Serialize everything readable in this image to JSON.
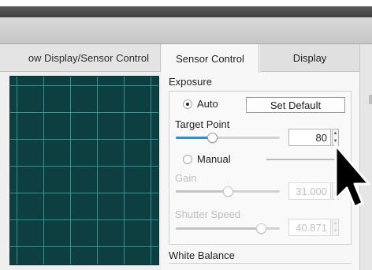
{
  "left_pane": {
    "tab_label": "ow Display/Sensor Control"
  },
  "tabs": [
    {
      "label": "Sensor Control",
      "selected": true
    },
    {
      "label": "Display",
      "selected": false
    }
  ],
  "exposure": {
    "title": "Exposure",
    "auto_label": "Auto",
    "auto_selected": true,
    "set_default_label": "Set Default",
    "target_point": {
      "label": "Target Point",
      "value": "80",
      "slider_fraction": 0.35
    },
    "manual_label": "Manual",
    "manual_selected": false,
    "gain": {
      "label": "Gain",
      "value": "31.000",
      "slider_fraction": 0.5,
      "enabled": false
    },
    "shutter_speed": {
      "label": "Shutter Speed",
      "value": "40.871",
      "slider_fraction": 0.82,
      "enabled": false
    }
  },
  "white_balance": {
    "title": "White Balance"
  },
  "stepper_glyphs": {
    "up": "▲",
    "down": "▼"
  },
  "colors": {
    "accent_slider": "#3d86d6",
    "preview_bg": "#0d3f41",
    "preview_grid": "#3cafaf"
  },
  "icons": {
    "cursor": "arrow-pointer-icon"
  }
}
